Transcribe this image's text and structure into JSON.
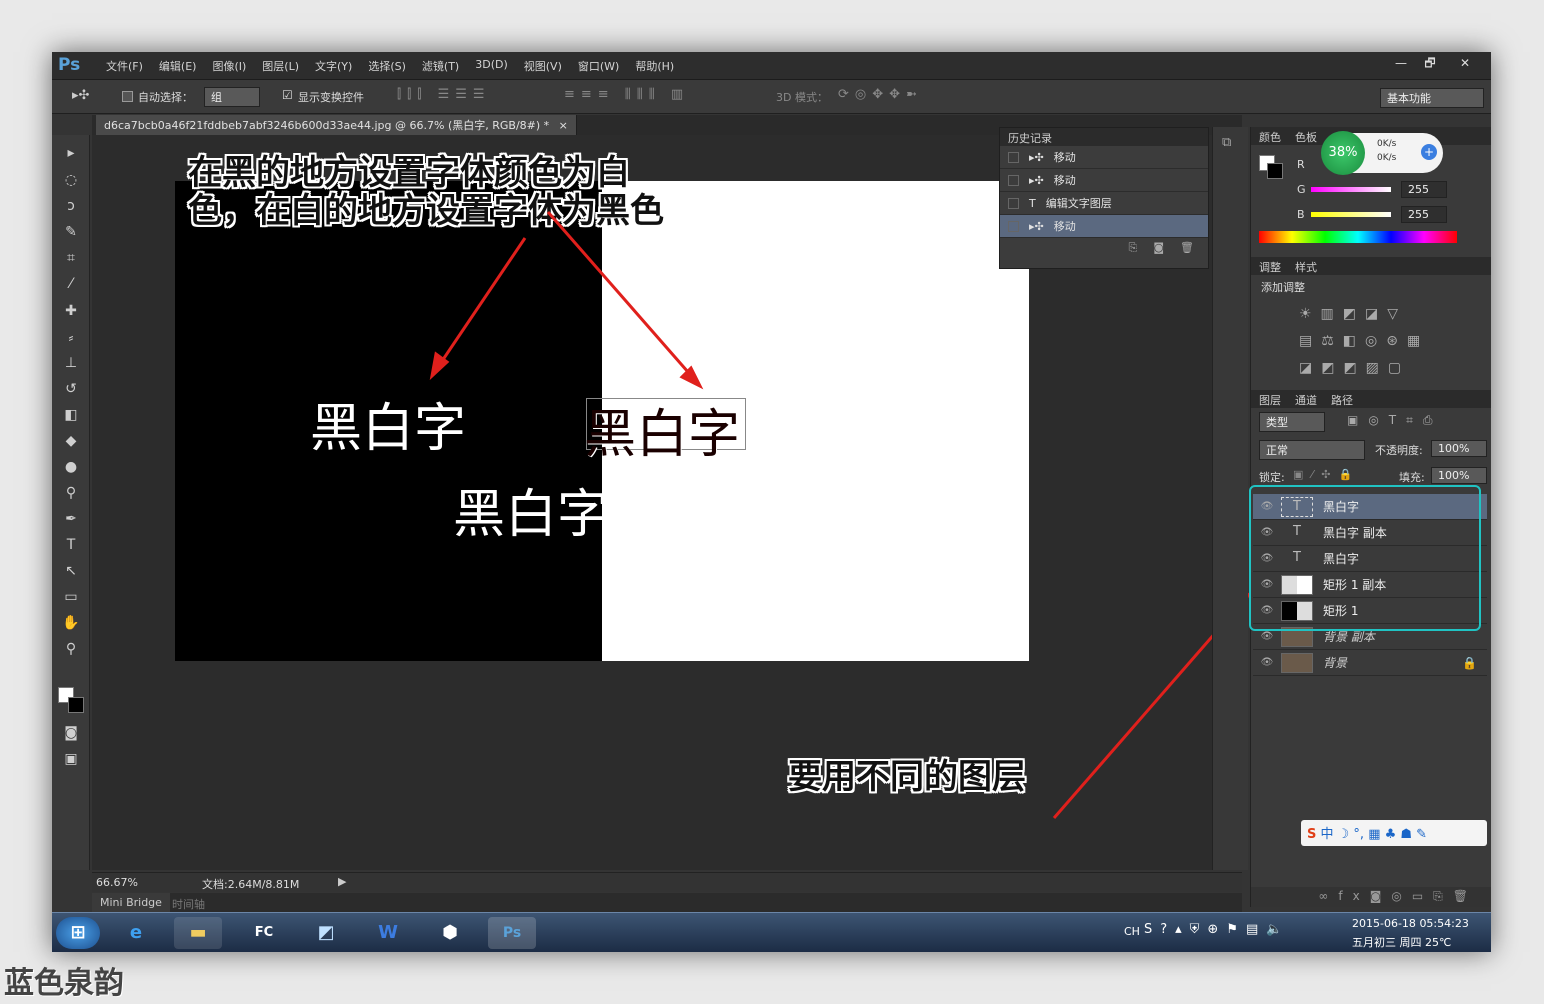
{
  "app": {
    "logo": "Ps"
  },
  "menu": [
    "文件(F)",
    "编辑(E)",
    "图像(I)",
    "图层(L)",
    "文字(Y)",
    "选择(S)",
    "滤镜(T)",
    "3D(D)",
    "视图(V)",
    "窗口(W)",
    "帮助(H)"
  ],
  "window_controls": {
    "minimize": "—",
    "restore": "🗗",
    "close": "✕"
  },
  "options": {
    "auto_select_label": "自动选择：",
    "auto_select_value": "组",
    "show_transform_label": "显示变换控件",
    "mode_3d_label": "3D 模式：",
    "workspace": "基本功能"
  },
  "document": {
    "tab_title": "d6ca7bcb0a46f21fddbeb7abf3246b600d33ae44.jpg @ 66.7% (黑白字, RGB/8#) *",
    "tab_close": "×",
    "zoom": "66.67%",
    "doc_info": "文档:2.64M/8.81M"
  },
  "canvas": {
    "text1": "黑白字",
    "text2": "黑白字",
    "text3": "黑白字"
  },
  "annotations": {
    "top": "在黑的地方设置字体颜色为白色，在白的地方设置字体为黑色",
    "bottom": "要用不同的图层"
  },
  "history": {
    "title": "历史记录",
    "items": [
      {
        "label": "移动",
        "active": false
      },
      {
        "label": "移动",
        "active": false
      },
      {
        "label": "编辑文字图层",
        "active": false
      },
      {
        "label": "移动",
        "active": true
      }
    ]
  },
  "color_panel": {
    "tabs": [
      "颜色",
      "色板"
    ],
    "r_label": "R",
    "g_label": "G",
    "b_label": "B",
    "g_value": "255",
    "b_value": "255"
  },
  "net_widget": {
    "percent": "38%",
    "up": "0K/s",
    "down": "0K/s"
  },
  "adjust_panel": {
    "tabs": [
      "调整",
      "样式"
    ],
    "title": "添加调整"
  },
  "layers_panel": {
    "tabs": [
      "图层",
      "通道",
      "路径"
    ],
    "filter": "类型",
    "blend_mode": "正常",
    "opacity_label": "不透明度:",
    "opacity": "100%",
    "lock_label": "锁定:",
    "fill_label": "填充:",
    "fill": "100%",
    "layers": [
      {
        "name": "黑白字",
        "type": "text",
        "selected": true
      },
      {
        "name": "黑白字 副本",
        "type": "text",
        "selected": false
      },
      {
        "name": "黑白字",
        "type": "text",
        "selected": false
      },
      {
        "name": "矩形 1 副本",
        "type": "white",
        "selected": false
      },
      {
        "name": "矩形 1",
        "type": "black",
        "selected": false
      },
      {
        "name": "背景 副本",
        "type": "photo",
        "selected": false
      },
      {
        "name": "背景",
        "type": "photo",
        "selected": false
      }
    ]
  },
  "bottom_tabs": [
    "Mini Bridge",
    "时间轴"
  ],
  "taskbar": {
    "ime": "CH",
    "date": "2015-06-18",
    "time": "05:54:23",
    "lunar": "五月初三 周四 25℃"
  },
  "watermark": "蓝色泉韵"
}
